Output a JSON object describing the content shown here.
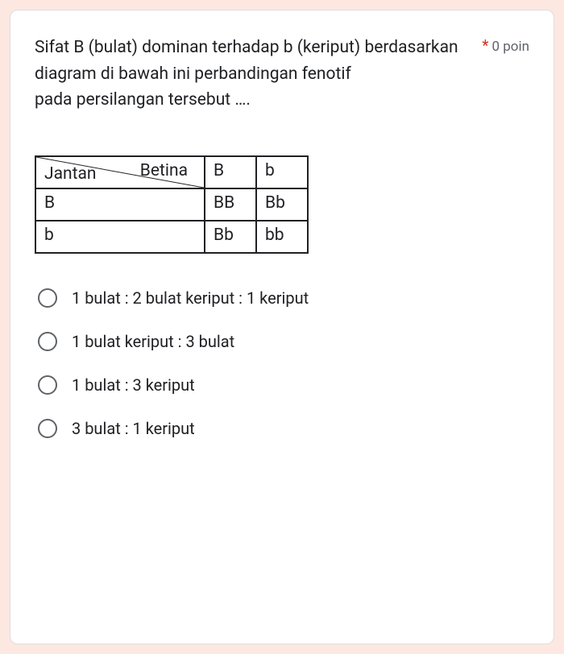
{
  "question": {
    "text": "Sifat B (bulat) dominan terhadap b (keriput) berdasarkan\ndiagram di bawah ini perbandingan fenotif\npada persilangan tersebut ….",
    "required_mark": "*",
    "points": "0 poin"
  },
  "table": {
    "col_label": "Betina",
    "row_label": "Jantan",
    "cols": [
      "B",
      "b"
    ],
    "rows": [
      "B",
      "b"
    ],
    "cells": [
      [
        "BB",
        "Bb"
      ],
      [
        "Bb",
        "bb"
      ]
    ]
  },
  "options": [
    "1 bulat : 2 bulat keriput : 1 keriput",
    "1 bulat keriput : 3 bulat",
    "1 bulat : 3 keriput",
    "3 bulat : 1 keriput"
  ]
}
